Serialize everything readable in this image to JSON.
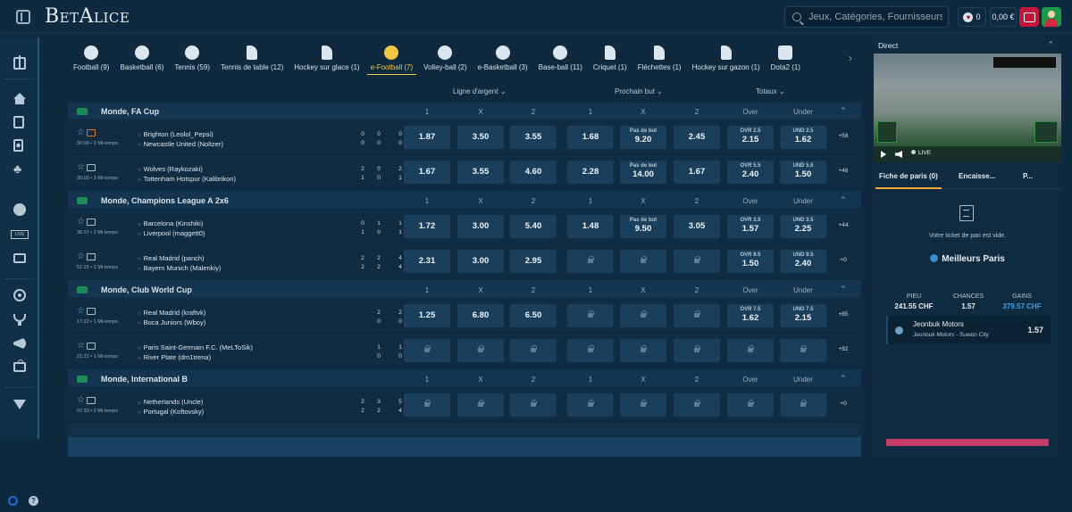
{
  "header": {
    "logo": "BetAlice",
    "search_placeholder": "Jeux, Catégories, Fournisseurs",
    "loyalty_count": "0",
    "balance": "0,00 €"
  },
  "sports": [
    {
      "label": "Football (9)",
      "icon": "football-icon"
    },
    {
      "label": "Basketball (6)",
      "icon": "basketball-icon"
    },
    {
      "label": "Tennis (59)",
      "icon": "tennis-icon"
    },
    {
      "label": "Tennis de table (12)",
      "icon": "table-tennis-icon"
    },
    {
      "label": "Hockey sur glace (1)",
      "icon": "ice-hockey-icon"
    },
    {
      "label": "e-Football (7)",
      "icon": "e-football-icon",
      "active": true
    },
    {
      "label": "Volley-ball (2)",
      "icon": "volleyball-icon"
    },
    {
      "label": "e-Basketball (3)",
      "icon": "e-basketball-icon"
    },
    {
      "label": "Base-ball (11)",
      "icon": "baseball-icon"
    },
    {
      "label": "Criquet (1)",
      "icon": "cricket-icon"
    },
    {
      "label": "Fléchettes (1)",
      "icon": "darts-icon"
    },
    {
      "label": "Hockey sur gazon (1)",
      "icon": "field-hockey-icon"
    },
    {
      "label": "Dota2 (1)",
      "icon": "dota2-icon"
    }
  ],
  "markets": {
    "m1": "Ligne d'argent",
    "m2": "Prochain but",
    "m3": "Totaux"
  },
  "col_labels": [
    "1",
    "X",
    "2",
    "1",
    "X",
    "2",
    "Over",
    "Under"
  ],
  "competitions": [
    {
      "name": "Monde, FA Cup",
      "matches": [
        {
          "time": "30:00 • 2 Mi-temps",
          "t1": "Brighton (Leolol_Pepsi)",
          "t2": "Newcastle United (Noltzer)",
          "s1": [
            "0",
            "0",
            "0"
          ],
          "s2": [
            "0",
            "0",
            "0"
          ],
          "tv_live": true,
          "odds": [
            {
              "v": "1.87"
            },
            {
              "v": "3.50"
            },
            {
              "v": "3.55"
            },
            {
              "v": "1.68"
            },
            {
              "t": "Pas de but",
              "v": "9.20"
            },
            {
              "v": "2.45"
            },
            {
              "t": "OVR 2.5",
              "v": "2.15"
            },
            {
              "t": "UND 2.5",
              "v": "1.62"
            }
          ],
          "more": "+58"
        },
        {
          "time": "30:00 • 2 Mi-temps",
          "t1": "Wolves (Raykozaki)",
          "t2": "Tottenham Hotspur (Kalibrikon)",
          "s1": [
            "2",
            "0",
            "2"
          ],
          "s2": [
            "1",
            "0",
            "1"
          ],
          "odds": [
            {
              "v": "1.67"
            },
            {
              "v": "3.55"
            },
            {
              "v": "4.60"
            },
            {
              "v": "2.28"
            },
            {
              "t": "Pas de but",
              "v": "14.00"
            },
            {
              "v": "1.67"
            },
            {
              "t": "OVR 5.5",
              "v": "2.40"
            },
            {
              "t": "UND 5.5",
              "v": "1.50"
            }
          ],
          "more": "+46"
        }
      ]
    },
    {
      "name": "Monde, Champions League A 2x6",
      "matches": [
        {
          "time": "35:37 • 2 Mi-temps",
          "t1": "Barcelona (Kinshiki)",
          "t2": "Liverpool (maggett0)",
          "s1": [
            "0",
            "1",
            "1"
          ],
          "s2": [
            "1",
            "0",
            "1"
          ],
          "odds": [
            {
              "v": "1.72"
            },
            {
              "v": "3.00"
            },
            {
              "v": "5.40"
            },
            {
              "v": "1.48"
            },
            {
              "t": "Pas de but",
              "v": "9.50"
            },
            {
              "v": "3.05"
            },
            {
              "t": "OVR 3.5",
              "v": "1.57"
            },
            {
              "t": "UND 3.5",
              "v": "2.25"
            }
          ],
          "more": "+44"
        },
        {
          "time": "51:15 • 2 Mi-temps",
          "t1": "Real Madrid (panch)",
          "t2": "Bayern Munich (Malenkiy)",
          "s1": [
            "2",
            "2",
            "4"
          ],
          "s2": [
            "2",
            "2",
            "4"
          ],
          "odds": [
            {
              "v": "2.31"
            },
            {
              "v": "3.00"
            },
            {
              "v": "2.95"
            },
            {
              "lock": true
            },
            {
              "lock": true
            },
            {
              "lock": true
            },
            {
              "t": "OVR 9.5",
              "v": "1.50"
            },
            {
              "t": "UND 9.5",
              "v": "2.40"
            }
          ],
          "more": "+0"
        }
      ]
    },
    {
      "name": "Monde, Club World Cup",
      "matches": [
        {
          "time": "17:22 • 1 Mi-temps",
          "t1": "Real Madrid (kraftvk)",
          "t2": "Boca Juniors (Wboy)",
          "s1": [
            "",
            "2",
            "2"
          ],
          "s2": [
            "",
            "0",
            "0"
          ],
          "odds": [
            {
              "v": "1.25"
            },
            {
              "v": "6.80"
            },
            {
              "v": "6.50"
            },
            {
              "lock": true
            },
            {
              "lock": true
            },
            {
              "lock": true
            },
            {
              "t": "OVR 7.5",
              "v": "1.62"
            },
            {
              "t": "UND 7.5",
              "v": "2.15"
            }
          ],
          "more": "+85"
        },
        {
          "time": "21:22 • 1 Mi-temps",
          "t1": "Paris Saint-Germain F.C. (MeLToSik)",
          "t2": "River Plate (dm1trena)",
          "s1": [
            "",
            "1",
            "1"
          ],
          "s2": [
            "",
            "0",
            "0"
          ],
          "odds": [
            {
              "lock": true
            },
            {
              "lock": true
            },
            {
              "lock": true
            },
            {
              "lock": true
            },
            {
              "lock": true
            },
            {
              "lock": true
            },
            {
              "lock": true
            },
            {
              "lock": true
            }
          ],
          "more": "+92"
        }
      ]
    },
    {
      "name": "Monde, International B",
      "matches": [
        {
          "time": "07:33 • 2 Mi-temps",
          "t1": "Netherlands (Uncle)",
          "t2": "Portugal (Koftovsky)",
          "s1": [
            "2",
            "3",
            "5"
          ],
          "s2": [
            "2",
            "2",
            "4"
          ],
          "odds": [
            {
              "lock": true
            },
            {
              "lock": true
            },
            {
              "lock": true
            },
            {
              "lock": true
            },
            {
              "lock": true
            },
            {
              "lock": true
            },
            {
              "lock": true
            },
            {
              "lock": true
            }
          ],
          "more": "+0"
        }
      ]
    }
  ],
  "live": {
    "title": "Direct",
    "badge": "LIVE"
  },
  "betslip": {
    "tabs": [
      "Fiche de paris (0)",
      "Encaisse...",
      "P..."
    ],
    "empty": "Votre ticket de pari est vide.",
    "best_title": "Meilleurs Paris",
    "cols": [
      "PIEU",
      "CHANCES",
      "GAINS"
    ],
    "stake": "241.55 CHF",
    "odds": "1.57",
    "gain": "379.57 CHF",
    "pick_team": "Jeonbuk Motors",
    "pick_match": "Jeonbuk Motors - Suwon City",
    "pick_odd": "1.57"
  }
}
